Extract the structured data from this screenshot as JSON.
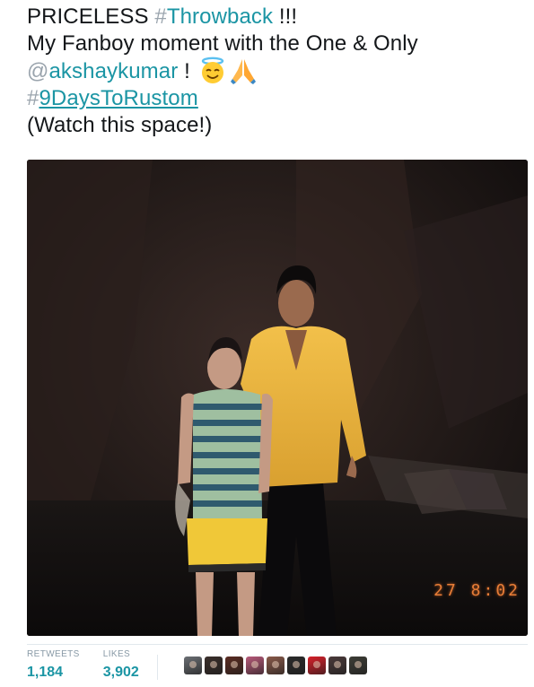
{
  "tweet": {
    "line1_text": "PRICELESS ",
    "line1_hashtag_symbol": "#",
    "line1_hashtag": "Throwback",
    "line1_suffix": " !!!",
    "line2_text": "My Fanboy moment with the One & Only",
    "line3_mention_symbol": "@",
    "line3_mention": "akshaykumar",
    "line3_suffix": " ! ",
    "line4_hashtag_symbol": "#",
    "line4_hashtag": "9DaysToRustom",
    "line5_text": "(Watch this space!)",
    "emojis": [
      "smiling-face-with-halo-icon",
      "folded-hands-icon"
    ]
  },
  "photo": {
    "date_stamp": "27 8:02"
  },
  "stats": {
    "retweets_label": "RETWEETS",
    "retweets_value": "1,184",
    "likes_label": "LIKES",
    "likes_value": "3,902"
  },
  "likers": {
    "count_shown": 9,
    "colors": [
      "#6b6f74",
      "#3a2f2b",
      "#5a2c22",
      "#b85a7a",
      "#8a5a4a",
      "#2b2b2b",
      "#d8202a",
      "#4a3a3a",
      "#3d3d36"
    ]
  },
  "colors": {
    "link": "#1b95a4",
    "text": "#14171a",
    "muted": "#8899a6"
  }
}
